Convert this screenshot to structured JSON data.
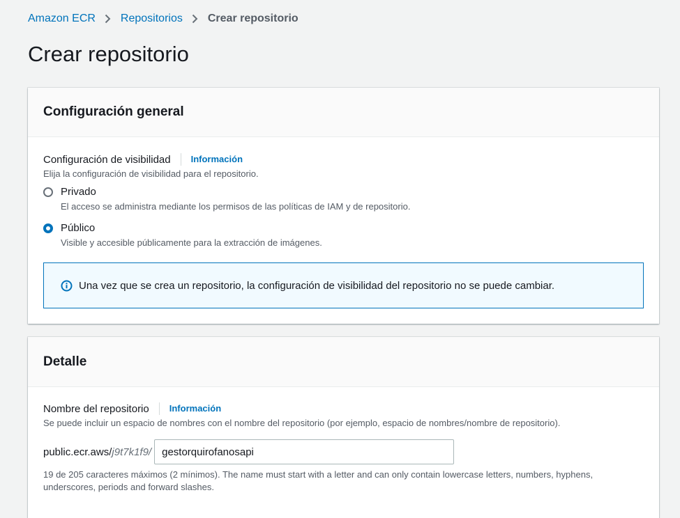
{
  "breadcrumb": {
    "items": [
      "Amazon ECR",
      "Repositorios"
    ],
    "current": "Crear repositorio"
  },
  "page": {
    "title": "Crear repositorio"
  },
  "general": {
    "title": "Configuración general",
    "visibility": {
      "label": "Configuración de visibilidad",
      "info": "Información",
      "description": "Elija la configuración de visibilidad para el repositorio.",
      "options": [
        {
          "label": "Privado",
          "description": "El acceso se administra mediante los permisos de las políticas de IAM y de repositorio.",
          "selected": false
        },
        {
          "label": "Público",
          "description": "Visible y accesible públicamente para la extracción de imágenes.",
          "selected": true
        }
      ]
    },
    "alert": "Una vez que se crea un repositorio, la configuración de visibilidad del repositorio no se puede cambiar."
  },
  "detail": {
    "title": "Detalle",
    "name": {
      "label": "Nombre del repositorio",
      "info": "Información",
      "description": "Se puede incluir un espacio de nombres con el nombre del repositorio (por ejemplo, espacio de nombres/nombre de repositorio).",
      "prefix_static": "public.ecr.aws/",
      "prefix_alias": "j9t7k1f9/",
      "value": "gestorquirofanosapi",
      "constraint": "19 de 205 caracteres máximos (2 mínimos). The name must start with a letter and can only contain lowercase letters, numbers, hyphens, underscores, periods and forward slashes."
    }
  },
  "colors": {
    "link": "#0073bb",
    "background": "#f2f3f3",
    "alert_background": "#f1faff",
    "text": "#16191f",
    "secondary_text": "#545b64"
  },
  "icons": {
    "breadcrumb_separator": "chevron-right-icon",
    "alert": "info-circle-icon"
  }
}
